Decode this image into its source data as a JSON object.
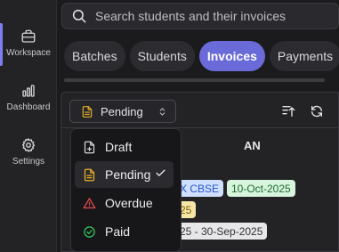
{
  "nav": {
    "items": [
      {
        "label": "Workspace",
        "icon": "briefcase-icon",
        "active": true
      },
      {
        "label": "Dashboard",
        "icon": "bar-chart-icon",
        "active": false
      },
      {
        "label": "Settings",
        "icon": "gear-icon",
        "active": false
      }
    ]
  },
  "search": {
    "placeholder": "Search students and their invoices"
  },
  "tabs": [
    {
      "label": "Batches",
      "active": false
    },
    {
      "label": "Students",
      "active": false
    },
    {
      "label": "Invoices",
      "active": true
    },
    {
      "label": "Payments",
      "active": false
    }
  ],
  "toolbar": {
    "filter_value": "Pending",
    "sort_icon": "sort-upload-icon",
    "refresh_icon": "refresh-icon"
  },
  "card": {
    "title_fragment": "AN",
    "chips": {
      "course": "X CBSE",
      "date": "10-Oct-2025",
      "status_fragment": "25",
      "period": "25 - 30-Sep-2025"
    }
  },
  "dropdown": {
    "options": [
      {
        "label": "Draft",
        "icon": "file-plus-icon",
        "selected": false
      },
      {
        "label": "Pending",
        "icon": "file-text-icon",
        "selected": true
      },
      {
        "label": "Overdue",
        "icon": "alert-triangle-icon",
        "selected": false
      },
      {
        "label": "Paid",
        "icon": "check-circle-icon",
        "selected": false
      }
    ]
  },
  "colors": {
    "accent": "#6a6bd8",
    "pending": "#e8b02a",
    "overdue": "#e5484d",
    "paid": "#34c759"
  }
}
